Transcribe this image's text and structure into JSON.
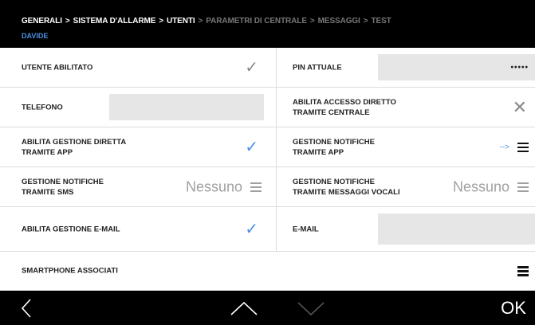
{
  "header": {
    "breadcrumb": [
      {
        "label": "GENERALI",
        "active": true
      },
      {
        "label": "SISTEMA D'ALLARME",
        "active": true
      },
      {
        "label": "UTENTI",
        "active": true
      },
      {
        "label": "PARAMETRI DI CENTRALE",
        "active": false
      },
      {
        "label": "MESSAGGI",
        "active": false
      },
      {
        "label": "TEST",
        "active": false
      }
    ],
    "separator": ">",
    "subtitle": "DAVIDE"
  },
  "rows": {
    "utente_abilitato": {
      "label": "UTENTE ABILITATO",
      "checked": true,
      "check_icon": "check-icon"
    },
    "pin_attuale": {
      "label": "PIN ATTUALE",
      "value": "•••••"
    },
    "telefono": {
      "label": "TELEFONO",
      "value": ""
    },
    "accesso_diretto": {
      "label1": "ABILITA ACCESSO DIRETTO",
      "label2": "TRAMITE CENTRALE",
      "checked": false,
      "icon": "close-icon"
    },
    "gestione_diretta": {
      "label1": "ABILITA GESTIONE DIRETTA",
      "label2": "TRAMITE APP",
      "checked": true
    },
    "notifiche_app": {
      "label1": "GESTIONE NOTIFICHE",
      "label2": "TRAMITE APP",
      "arrow": "-->"
    },
    "notifiche_sms": {
      "label1": "GESTIONE NOTIFICHE",
      "label2": "TRAMITE SMS",
      "value": "Nessuno"
    },
    "notifiche_vocali": {
      "label1": "GESTIONE NOTIFICHE",
      "label2": "TRAMITE MESSAGGI VOCALI",
      "value": "Nessuno"
    },
    "gestione_email": {
      "label": "ABILITA GESTIONE E-MAIL",
      "checked": true
    },
    "email": {
      "label": "E-MAIL",
      "value": ""
    },
    "smartphone": {
      "label": "SMARTPHONE ASSOCIATI"
    }
  },
  "footer": {
    "back_icon": "chevron-left-icon",
    "up_icon": "chevron-up-icon",
    "down_icon": "chevron-down-icon",
    "ok_label": "OK"
  },
  "colors": {
    "accent": "#4a90e2",
    "header_bg": "#000000",
    "field_bg": "#e6e6e6",
    "icon_grey": "#8a8a8a"
  }
}
